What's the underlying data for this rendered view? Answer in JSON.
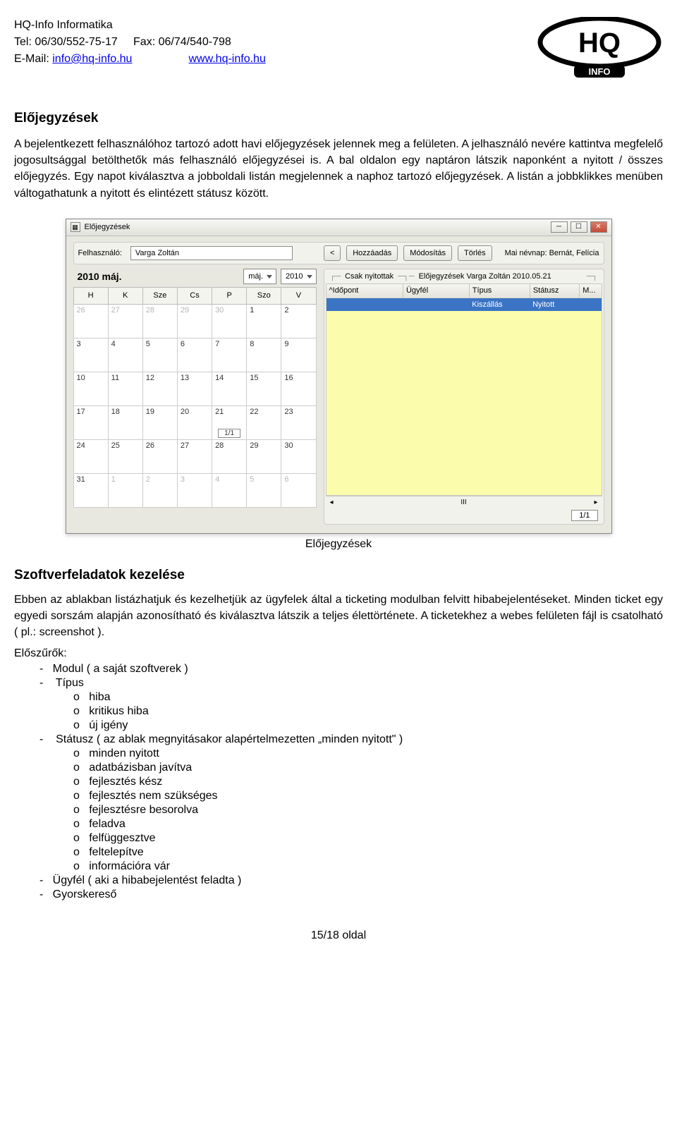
{
  "header": {
    "company": "HQ-Info Informatika",
    "tel_label": "Tel:",
    "tel": "06/30/552-75-17",
    "fax_label": "Fax:",
    "fax": "06/74/540-798",
    "email_label": "E-Mail:",
    "email": "info@hq-info.hu",
    "web": "www.hq-info.hu",
    "logo_main": "HQ",
    "logo_sub": "INFO"
  },
  "section1_title": "Előjegyzések",
  "para1": "A bejelentkezett felhasználóhoz tartozó adott havi előjegyzések jelennek meg a felületen. A jelhasználó nevére kattintva megfelelő jogosultsággal betölthetők más felhasználó előjegyzései is. A bal oldalon egy naptáron látszik naponként a nyitott / összes előjegyzés. Egy napot kiválasztva a jobboldali listán megjelennek a naphoz tartozó előjegyzések. A listán a jobbklikkes menüben váltogathatunk a nyitott és elintézett státusz között.",
  "app": {
    "title": "Előjegyzések",
    "user_label": "Felhasználó:",
    "user_value": "Varga Zoltán",
    "prev_btn": "<",
    "add_btn": "Hozzáadás",
    "edit_btn": "Módosítás",
    "delete_btn": "Törlés",
    "nameday": "Mai névnap: Bernát, Felícia",
    "month_title": "2010  máj.",
    "month_combo": "máj.",
    "year_combo": "2010",
    "dow": [
      "H",
      "K",
      "Sze",
      "Cs",
      "P",
      "Szo",
      "V"
    ],
    "weeks": [
      [
        {
          "d": "26",
          "dim": true
        },
        {
          "d": "27",
          "dim": true
        },
        {
          "d": "28",
          "dim": true
        },
        {
          "d": "29",
          "dim": true
        },
        {
          "d": "30",
          "dim": true
        },
        {
          "d": "1"
        },
        {
          "d": "2"
        }
      ],
      [
        {
          "d": "3"
        },
        {
          "d": "4"
        },
        {
          "d": "5"
        },
        {
          "d": "6"
        },
        {
          "d": "7"
        },
        {
          "d": "8"
        },
        {
          "d": "9"
        }
      ],
      [
        {
          "d": "10"
        },
        {
          "d": "11"
        },
        {
          "d": "12"
        },
        {
          "d": "13"
        },
        {
          "d": "14"
        },
        {
          "d": "15"
        },
        {
          "d": "16"
        }
      ],
      [
        {
          "d": "17"
        },
        {
          "d": "18"
        },
        {
          "d": "19"
        },
        {
          "d": "20"
        },
        {
          "d": "21",
          "sel": "1/1"
        },
        {
          "d": "22"
        },
        {
          "d": "23"
        }
      ],
      [
        {
          "d": "24"
        },
        {
          "d": "25"
        },
        {
          "d": "26"
        },
        {
          "d": "27"
        },
        {
          "d": "28"
        },
        {
          "d": "29"
        },
        {
          "d": "30"
        }
      ],
      [
        {
          "d": "31"
        },
        {
          "d": "1",
          "dim": true
        },
        {
          "d": "2",
          "dim": true
        },
        {
          "d": "3",
          "dim": true
        },
        {
          "d": "4",
          "dim": true
        },
        {
          "d": "5",
          "dim": true
        },
        {
          "d": "6",
          "dim": true
        }
      ]
    ],
    "group_filter": "Csak nyitottak",
    "group_title": "Előjegyzések Varga Zoltán 2010.05.21",
    "cols": [
      "^Időpont",
      "Ügyfél",
      "Típus",
      "Státusz",
      "M..."
    ],
    "row": {
      "c2": "",
      "c3": "Kiszállás",
      "c4": "Nyitott"
    },
    "scroll_marker": "III",
    "counter": "1/1"
  },
  "fig_caption": "Előjegyzések",
  "section2_title": "Szoftverfeladatok kezelése",
  "para2": "Ebben az ablakban listázhatjuk és kezelhetjük az ügyfelek által a ticketing modulban felvitt hibabejelentéseket. Minden ticket egy egyedi sorszám alapján azonosítható és kiválasztva látszik a teljes élettörténete. A ticketekhez a webes felületen fájl is csatolható ( pl.: screenshot ).",
  "filters_title": "Előszűrők:",
  "filters": {
    "f1": "Modul ( a saját szoftverek )",
    "f2": "Típus",
    "f2_items": [
      "hiba",
      "kritikus hiba",
      "új igény"
    ],
    "f3": "Státusz ( az ablak megnyitásakor alapértelmezetten „minden nyitott\" )",
    "f3_items": [
      "minden nyitott",
      "adatbázisban javítva",
      "fejlesztés kész",
      "fejlesztés nem szükséges",
      "fejlesztésre besorolva",
      "feladva",
      "felfüggesztve",
      "feltelepítve",
      "információra vár"
    ],
    "f4": "Ügyfél ( aki a hibabejelentést feladta )",
    "f5": "Gyorskereső"
  },
  "footer": "15/18 oldal"
}
